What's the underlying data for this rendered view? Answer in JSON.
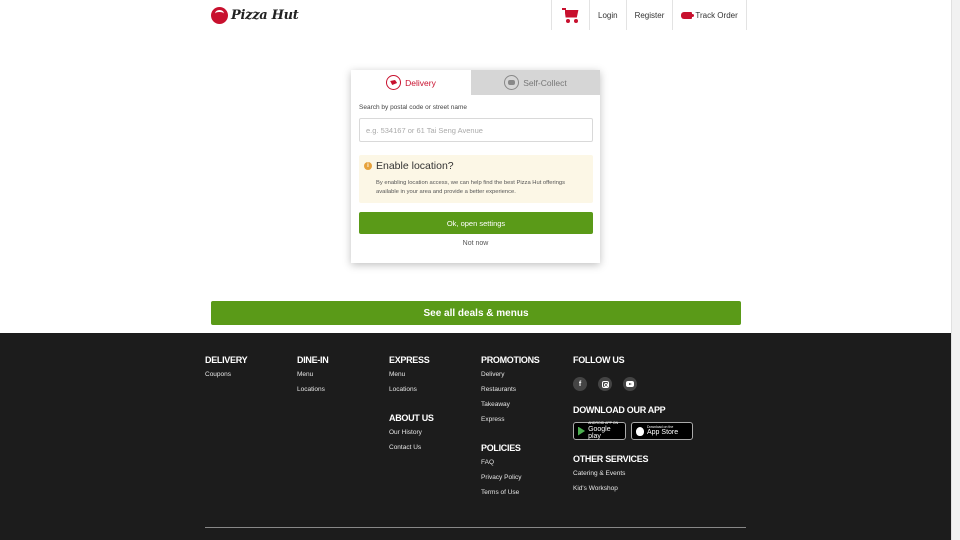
{
  "header": {
    "logo_text": "Pizza Hut",
    "nav": {
      "login": "Login",
      "register": "Register",
      "track_order": "Track Order"
    }
  },
  "location_card": {
    "tabs": [
      {
        "label": "Delivery",
        "active": true
      },
      {
        "label": "Self-Collect",
        "active": false
      }
    ],
    "search_label": "Search by postal code or street name",
    "search_placeholder": "e.g. 534167 or 61 Tai Seng Avenue",
    "notice": {
      "icon": "i",
      "title": "Enable location?",
      "body": "By enabling location access, we can help find the best Pizza Hut offerings available in your area and provide a better experience."
    },
    "ok_button": "Ok, open settings",
    "not_now": "Not now"
  },
  "deals_button": "See all deals & menus",
  "footer": {
    "delivery": {
      "title": "DELIVERY",
      "links": [
        "Coupons"
      ]
    },
    "dine_in": {
      "title": "DINE-IN",
      "links": [
        "Menu",
        "Locations"
      ]
    },
    "express": {
      "title": "EXPRESS",
      "links": [
        "Menu",
        "Locations"
      ]
    },
    "about": {
      "title": "ABOUT US",
      "links": [
        "Our History",
        "Contact Us"
      ]
    },
    "promotions": {
      "title": "PROMOTIONS",
      "links": [
        "Delivery",
        "Restaurants",
        "Takeaway",
        "Express"
      ]
    },
    "policies": {
      "title": "POLICIES",
      "links": [
        "FAQ",
        "Privacy Policy",
        "Terms of Use"
      ]
    },
    "follow": {
      "title": "FOLLOW US",
      "icons": [
        "facebook-icon",
        "instagram-icon",
        "youtube-icon"
      ],
      "facebook_glyph": "f"
    },
    "app": {
      "title": "DOWNLOAD OUR APP",
      "google": {
        "small": "ANDROID APP ON",
        "big": "Google play"
      },
      "apple": {
        "small": "Download on the",
        "big": "App Store"
      }
    },
    "other": {
      "title": "OTHER SERVICES",
      "links": [
        "Catering & Events",
        "Kid's Workshop"
      ]
    }
  },
  "colors": {
    "brand_red": "#c8102e",
    "cta_green": "#5a9a18",
    "footer_bg": "#1c1c1c"
  }
}
